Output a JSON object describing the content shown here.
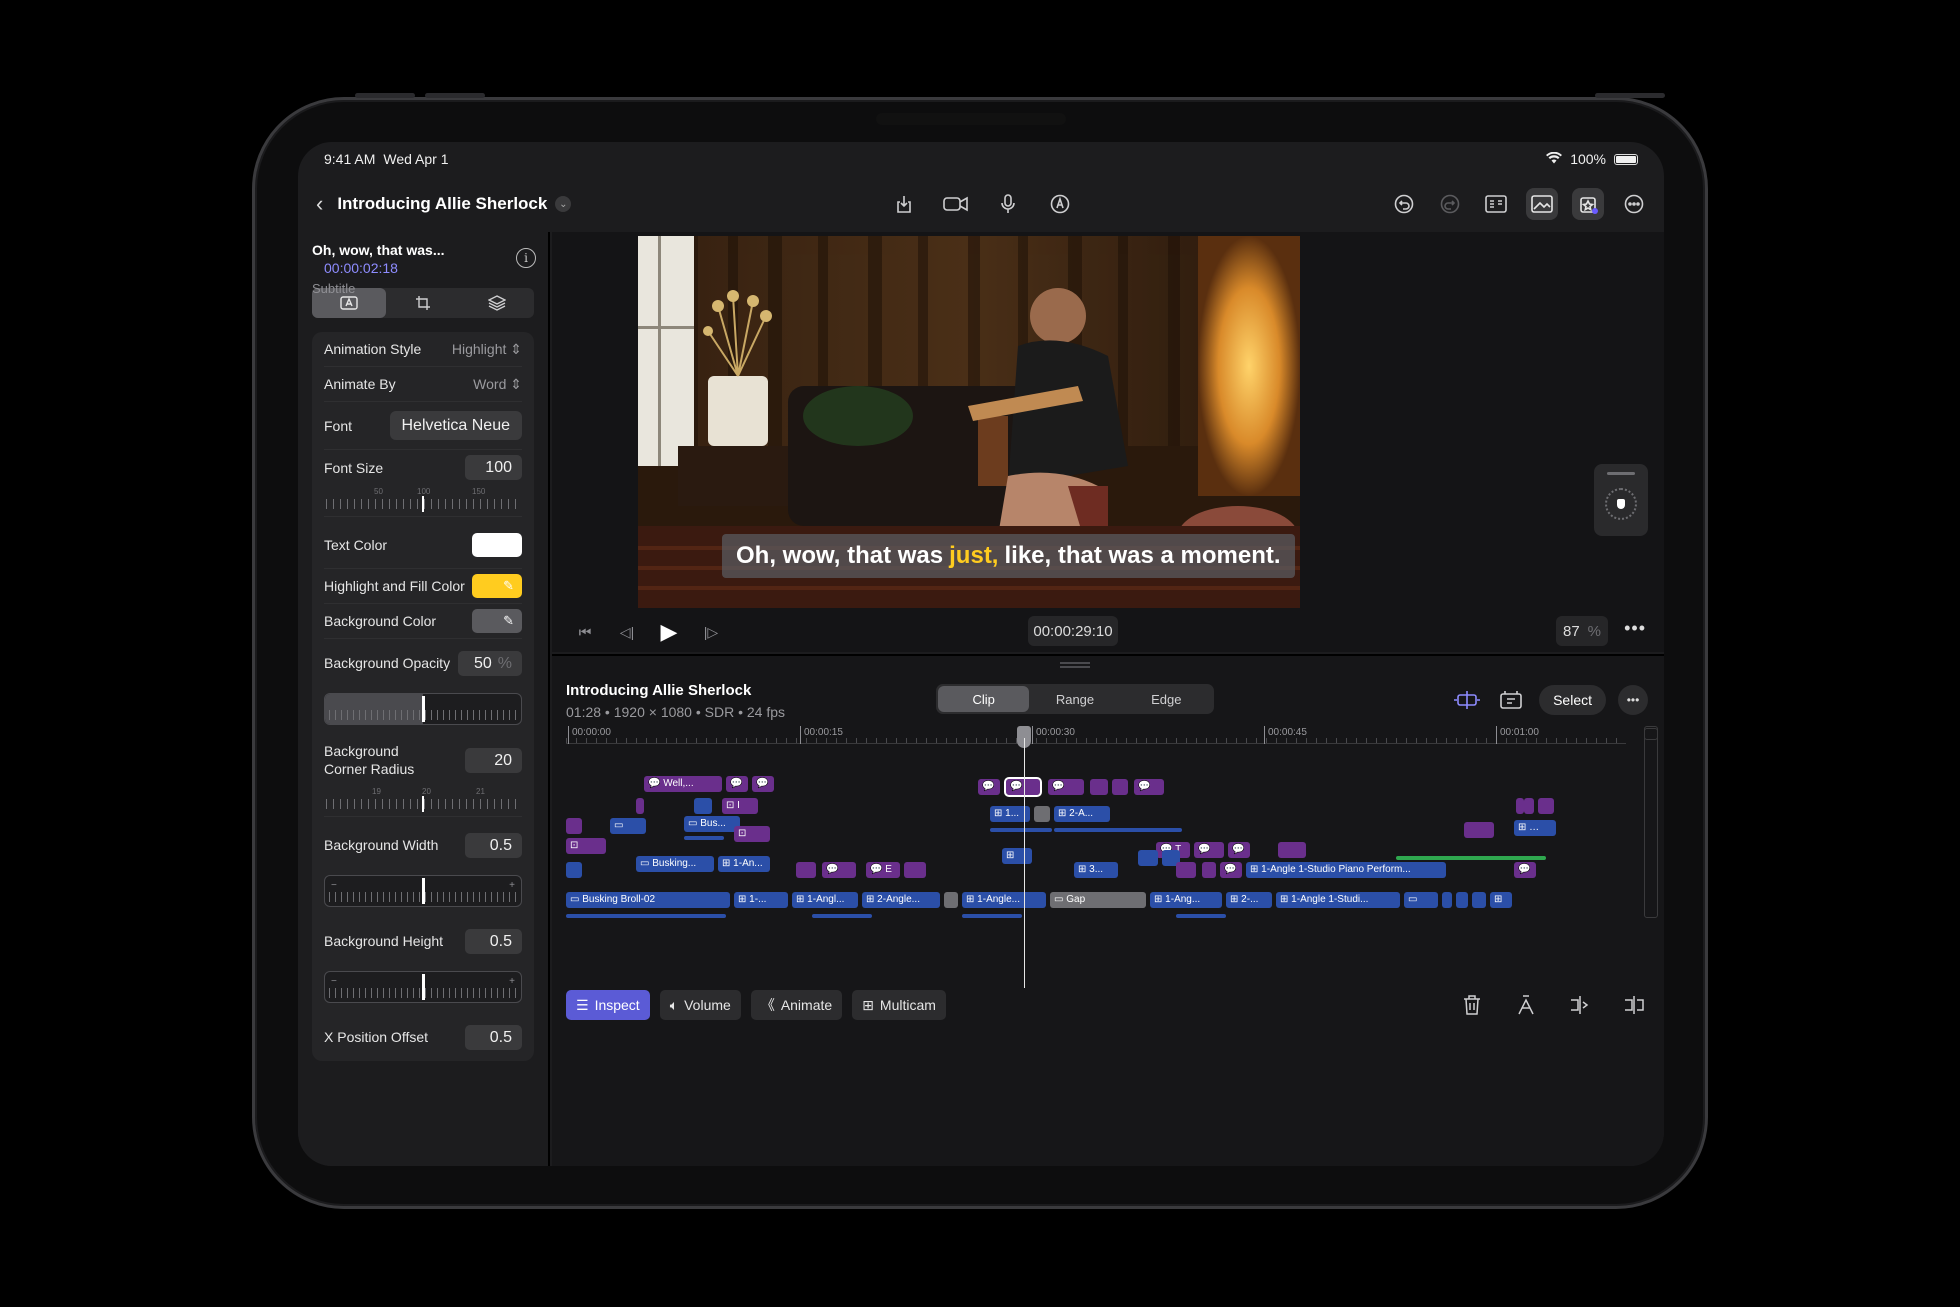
{
  "status_bar": {
    "time": "9:41 AM",
    "date": "Wed Apr 1",
    "battery": "100%"
  },
  "header": {
    "project_title": "Introducing Allie Sherlock",
    "icons_center": [
      "export-icon",
      "camera-icon",
      "microphone-icon",
      "pencil-icon"
    ],
    "icons_right": [
      "undo-icon",
      "redo-icon",
      "browser-icon",
      "photos-icon",
      "effects-icon",
      "more-icon"
    ]
  },
  "inspector": {
    "clip_name": "Oh, wow, that was...",
    "clip_timecode": "00:00:02:18",
    "clip_type": "Subtitle",
    "tabs": [
      "text-tab-icon",
      "transform-tab-icon",
      "layers-tab-icon"
    ],
    "rows": {
      "animation_style": {
        "label": "Animation Style",
        "value": "Highlight"
      },
      "animate_by": {
        "label": "Animate By",
        "value": "Word"
      },
      "font": {
        "label": "Font",
        "value": "Helvetica Neue"
      },
      "font_size": {
        "label": "Font Size",
        "value": "100",
        "ruler_ticks": [
          "50",
          "100",
          "150"
        ],
        "level": 0.5
      },
      "text_color": {
        "label": "Text Color",
        "color": "#ffffff"
      },
      "highlight_color": {
        "label": "Highlight and Fill Color",
        "color": "#ffcc1f"
      },
      "background_color": {
        "label": "Background Color",
        "color": "#5a5a5e"
      },
      "background_opacity": {
        "label": "Background Opacity",
        "value": "50",
        "unit": "%",
        "level": 0.5
      },
      "corner_radius": {
        "label_line1": "Background",
        "label_line2": "Corner Radius",
        "value": "20",
        "ruler_ticks": [
          "19",
          "20",
          "21"
        ],
        "level": 0.5
      },
      "background_width": {
        "label": "Background Width",
        "value": "0.5",
        "level": 0.5
      },
      "background_height": {
        "label": "Background Height",
        "value": "0.5",
        "level": 0.5
      },
      "x_offset": {
        "label": "X Position Offset",
        "value": "0.5"
      }
    }
  },
  "viewer": {
    "caption_before": "Oh, wow, that was",
    "caption_highlight": "just,",
    "caption_after": "like, that was a moment.",
    "timecode": "00:00:29:10",
    "zoom": "87",
    "zoom_unit": "%"
  },
  "timeline": {
    "project_name": "Introducing Allie Sherlock",
    "project_meta": "01:28 • 1920 × 1080 • SDR • 24 fps",
    "modes": [
      "Clip",
      "Range",
      "Edge"
    ],
    "active_mode": "Clip",
    "select_label": "Select",
    "ruler_marks": [
      "00:00:00",
      "00:00:15",
      "00:00:30",
      "00:00:45",
      "00:01:00"
    ],
    "clip_labels": {
      "well": "Well,...",
      "bus": "Bus...",
      "busking": "Busking...",
      "one_an": "1-An...",
      "two_a": "2-A...",
      "one_dots": "1...",
      "three": "3...",
      "e": "E",
      "t": "T",
      "i": "I",
      "piano": "1-Angle 1-Studio Piano Perform...",
      "broll": "Busking Broll-02",
      "one_dash": "1-...",
      "angl": "1-Angl...",
      "two_angle": "2-Angle...",
      "one_angle": "1-Angle...",
      "gap": "Gap",
      "one_ang": "1-Ang...",
      "two_dash": "2-...",
      "studi": "1-Angle 1-Studi..."
    },
    "tools": [
      "Inspect",
      "Volume",
      "Animate",
      "Multicam"
    ],
    "active_tool": "Inspect",
    "tool_icons": [
      "inspect-icon",
      "volume-icon",
      "animate-icon",
      "multicam-icon"
    ],
    "right_icons": [
      "trash-icon",
      "detach-icon",
      "split-icon",
      "trim-icon"
    ]
  }
}
